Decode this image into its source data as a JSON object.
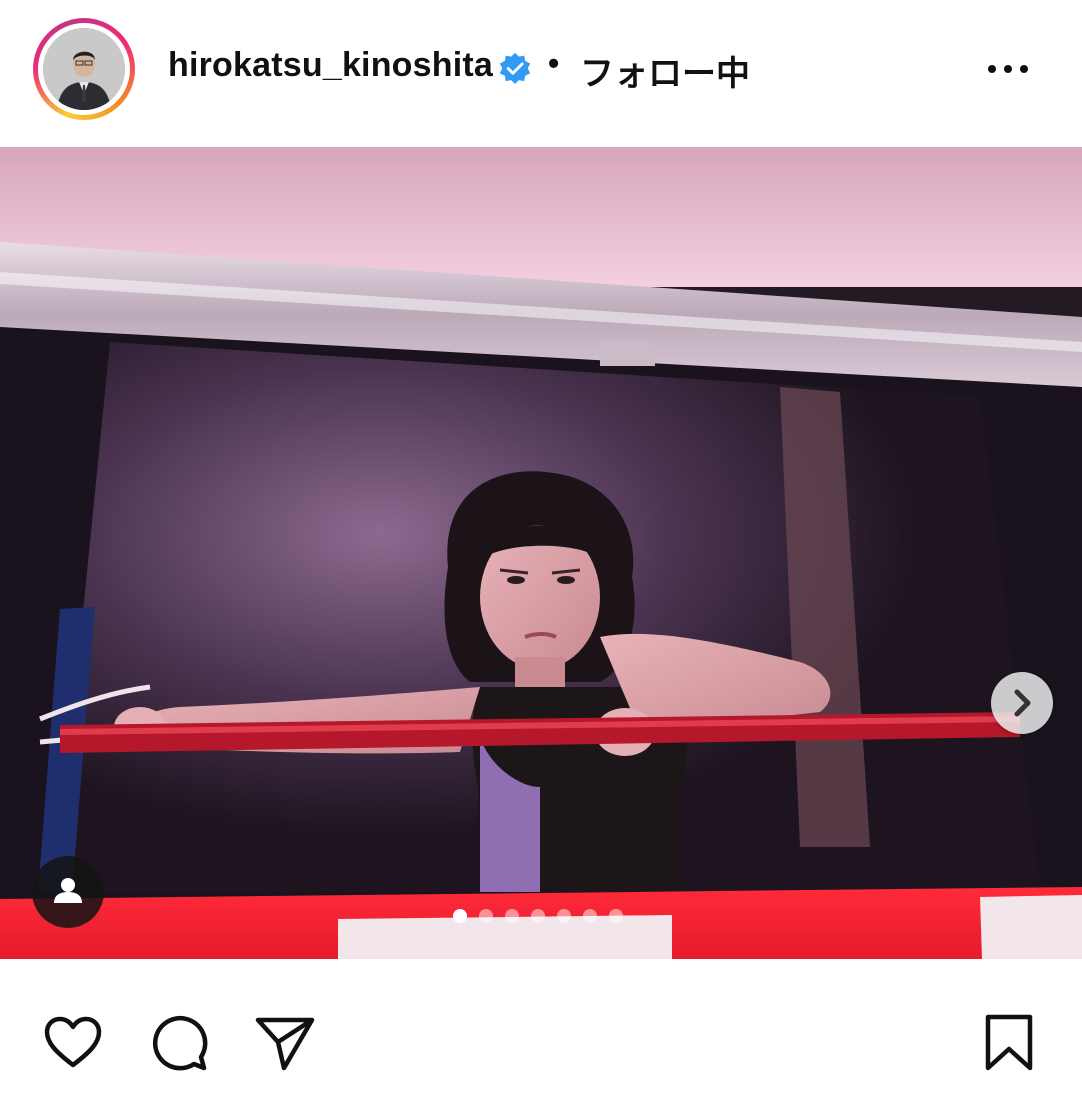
{
  "post": {
    "username": "hirokatsu_kinoshita",
    "verified": true,
    "separator": "•",
    "follow_status": "フォロー中"
  },
  "media": {
    "carousel_count": 7,
    "active_index": 0
  },
  "icons": {
    "more": "more-options-icon",
    "next": "chevron-right-icon",
    "tag": "user-tag-icon",
    "like": "heart-icon",
    "comment": "comment-icon",
    "share": "send-icon",
    "save": "bookmark-icon"
  },
  "colors": {
    "verified": "#2f9bf5",
    "ring_start": "#f9ce34",
    "ring_mid": "#ee2a7b",
    "ring_end": "#c13584"
  }
}
